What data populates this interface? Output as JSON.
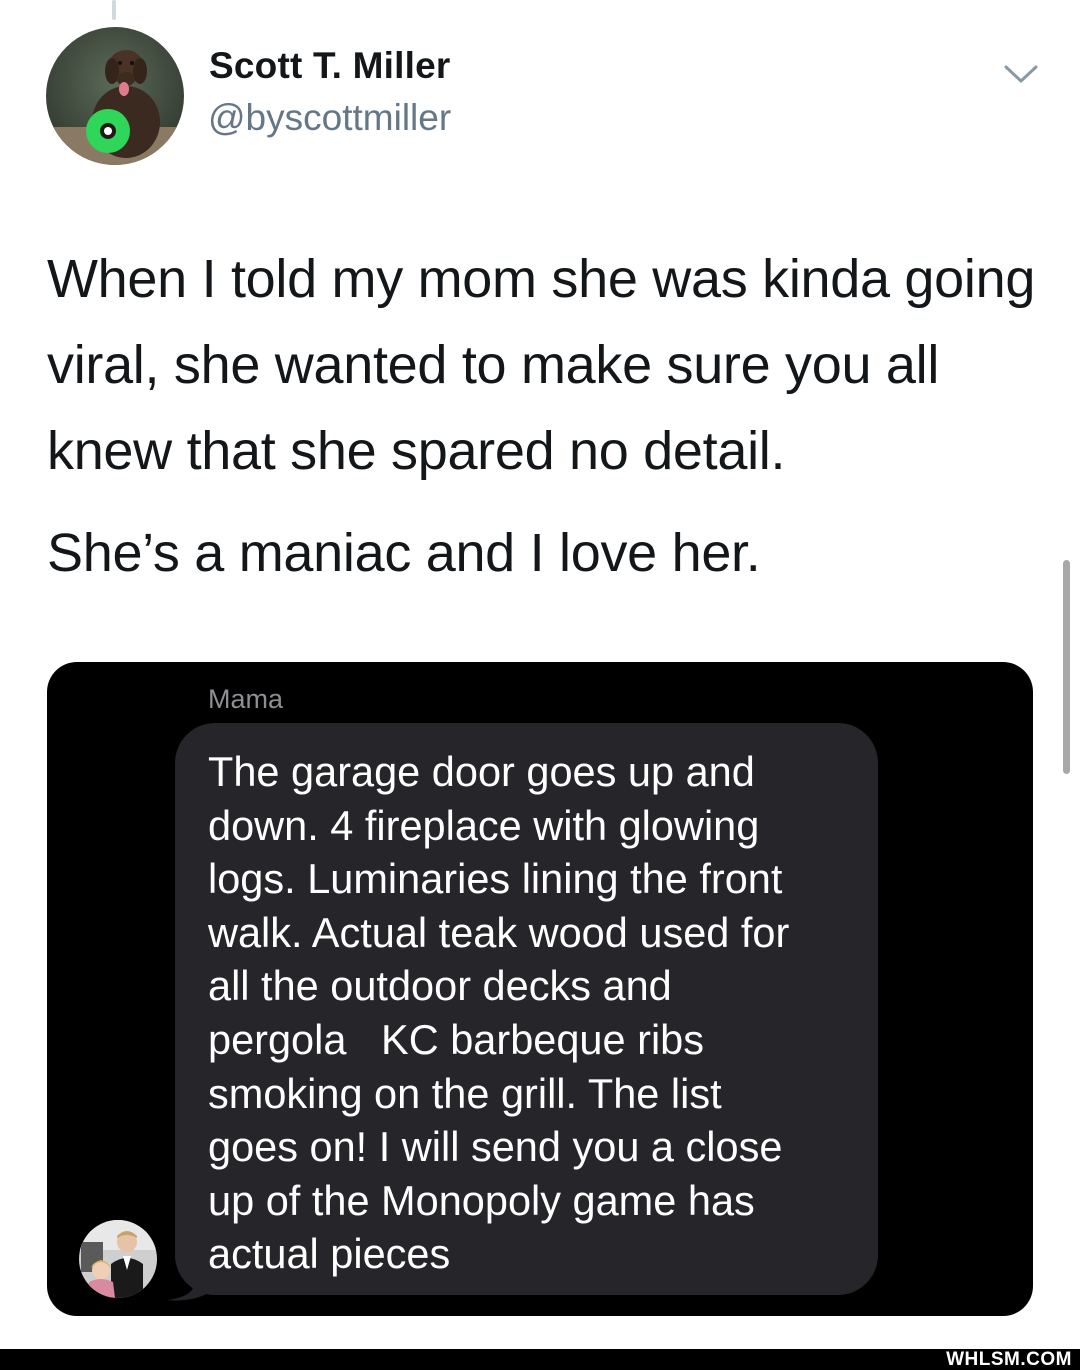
{
  "tweet": {
    "author_name": "Scott T. Miller",
    "author_handle": "@byscottmiller",
    "text": "When I told my mom she was kinda going viral, she wanted to make sure you all knew that she spared no detail.",
    "text2": "She’s a maniac and I love her.",
    "icons": {
      "caret": "chevron-down-icon",
      "avatar": "dog-with-green-ring-avatar"
    }
  },
  "message": {
    "sender": "Mama",
    "body": "The garage door goes up and\ndown. 4 fireplace with glowing\nlogs. Luminaries lining the front\nwalk. Actual teak wood used for\nall the outdoor decks and\npergola   KC barbeque ribs\nsmoking on the grill. The list\ngoes on! I will send you a close\nup of the Monopoly game has\nactual pieces",
    "colors": {
      "background": "#000000",
      "bubble": "#26252a",
      "text": "#ffffff"
    }
  },
  "watermark": "WHLSM.COM"
}
